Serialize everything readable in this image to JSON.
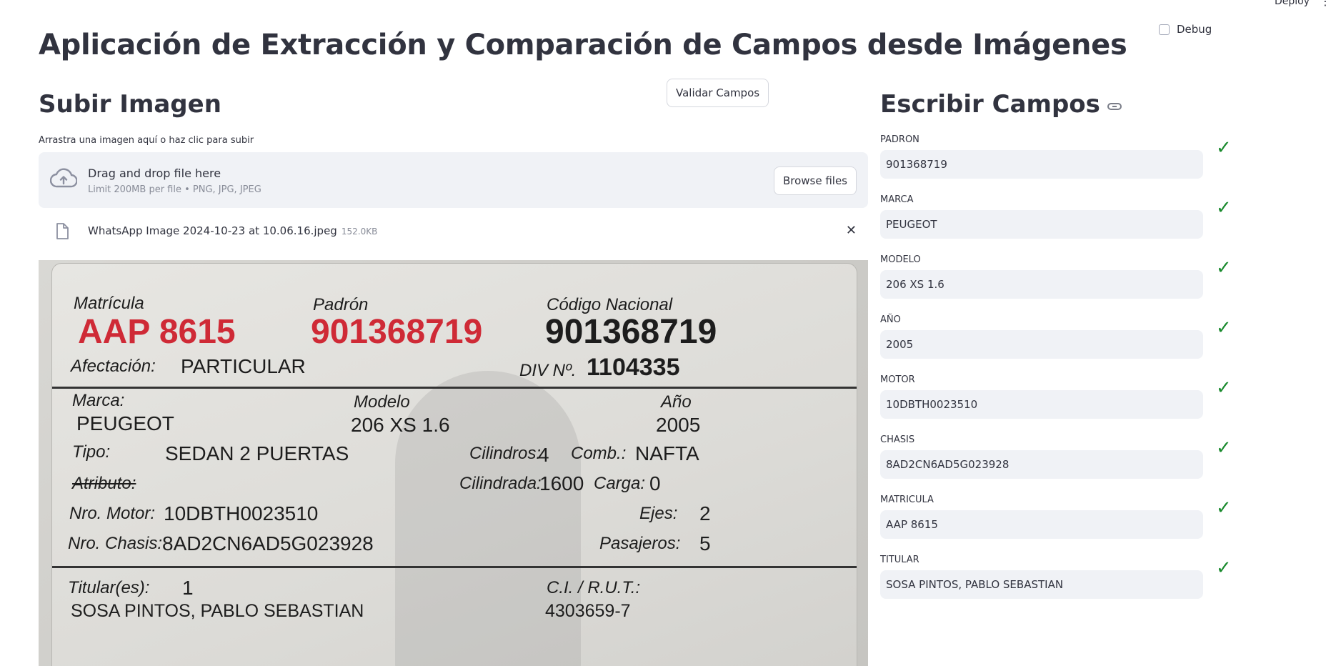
{
  "header": {
    "deploy_label": "Deploy",
    "menu_glyph": "⋮",
    "debug_label": "Debug",
    "title": "Aplicación de Extracción y Comparación de Campos desde Imágenes"
  },
  "validate_button": "Validar Campos",
  "upload": {
    "heading": "Subir Imagen",
    "label": "Arrastra una imagen aquí o haz clic para subir",
    "drop_text": "Drag and drop file here",
    "limit_text": "Limit 200MB per file • PNG, JPG, JPEG",
    "browse_label": "Browse files",
    "file_name": "WhatsApp Image 2024-10-23 at 10.06.16.jpeg",
    "file_size": "152.0KB",
    "close_glyph": "✕"
  },
  "document": {
    "matricula_label": "Matrícula",
    "matricula": "AAP 8615",
    "padron_label": "Padrón",
    "padron": "901368719",
    "codigo_label": "Código Nacional",
    "codigo": "901368719",
    "afectacion_label": "Afectación:",
    "afectacion": "PARTICULAR",
    "div_label": "DIV Nº.",
    "div": "1104335",
    "marca_label": "Marca:",
    "marca": "PEUGEOT",
    "modelo_label": "Modelo",
    "modelo": "206 XS 1.6",
    "anio_label": "Año",
    "anio": "2005",
    "tipo_label": "Tipo:",
    "tipo": "SEDAN 2 PUERTAS",
    "cilindros_label": "Cilindros:",
    "cilindros": "4",
    "comb_label": "Comb.:",
    "comb": "NAFTA",
    "atributo_label": "Atributo:",
    "cilindrada_label": "Cilindrada:",
    "cilindrada": "1600",
    "carga_label": "Carga:",
    "carga": "0",
    "motor_label": "Nro. Motor:",
    "motor": "10DBTH0023510",
    "ejes_label": "Ejes:",
    "ejes": "2",
    "chasis_label": "Nro. Chasis:",
    "chasis": "8AD2CN6AD5G023928",
    "pasajeros_label": "Pasajeros:",
    "pasajeros": "5",
    "titular_label": "Titular(es):",
    "titular_count": "1",
    "ci_label": "C.I. / R.U.T.:",
    "titular": "SOSA PINTOS, PABLO SEBASTIAN",
    "ci": "4303659-7"
  },
  "fields": {
    "heading": "Escribir Campos",
    "check_glyph": "✓",
    "items": [
      {
        "label": "PADRON",
        "value": "901368719"
      },
      {
        "label": "MARCA",
        "value": "PEUGEOT"
      },
      {
        "label": "MODELO",
        "value": "206 XS 1.6"
      },
      {
        "label": "AÑO",
        "value": "2005"
      },
      {
        "label": "MOTOR",
        "value": "10DBTH0023510"
      },
      {
        "label": "CHASIS",
        "value": "8AD2CN6AD5G023928"
      },
      {
        "label": "MATRICULA",
        "value": "AAP 8615"
      },
      {
        "label": "TITULAR",
        "value": "SOSA PINTOS, PABLO SEBASTIAN"
      }
    ]
  }
}
